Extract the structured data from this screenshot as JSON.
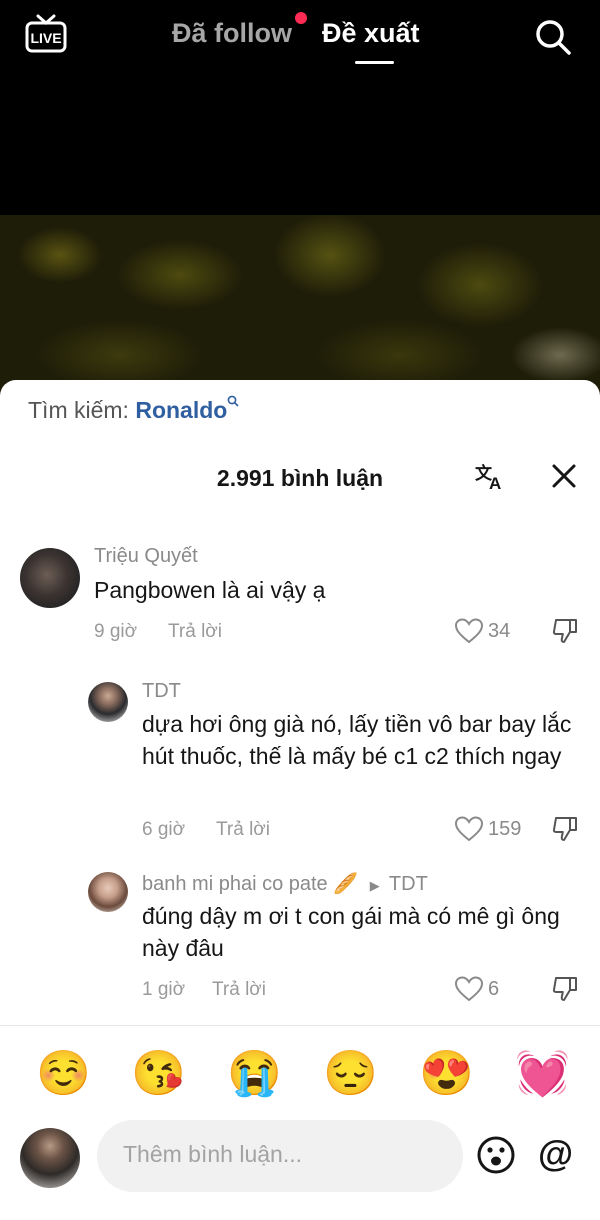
{
  "top_nav": {
    "tabs": [
      {
        "label": "Đã follow",
        "active": false,
        "has_dot": true
      },
      {
        "label": "Đề xuất",
        "active": true
      }
    ],
    "live_label": "LIVE",
    "accent_dot_color": "#fe2c55"
  },
  "comments_sheet": {
    "search_prefix": "Tìm kiếm:",
    "search_query": "Ronaldo",
    "count_label": "2.991 bình luận",
    "icons": [
      "translate-icon",
      "close-icon"
    ]
  },
  "comments": [
    {
      "author": "Triệu Quyết",
      "text": "Pangbowen là ai vậy ạ",
      "time": "9 giờ",
      "reply_label": "Trả lời",
      "likes": "34"
    },
    {
      "author": "TDT",
      "text": "dựa hơi ông già nó, lấy tiền vô bar bay lắc hút thuốc, thế là mấy bé c1 c2 thích ngay",
      "time": "6 giờ",
      "reply_label": "Trả lời",
      "likes": "159"
    },
    {
      "author": "banh mi phai co pate 🥖",
      "reply_to": "TDT",
      "text": "đúng dậy m ơi t con gái mà có mê gì ông này đâu",
      "time": "1 giờ",
      "reply_label": "Trả lời",
      "likes": "6"
    }
  ],
  "quick_emojis": [
    "☺️",
    "😘",
    "😭",
    "😔",
    "😍",
    "💓"
  ],
  "comment_input": {
    "placeholder": "Thêm bình luận...",
    "at_label": "@"
  }
}
